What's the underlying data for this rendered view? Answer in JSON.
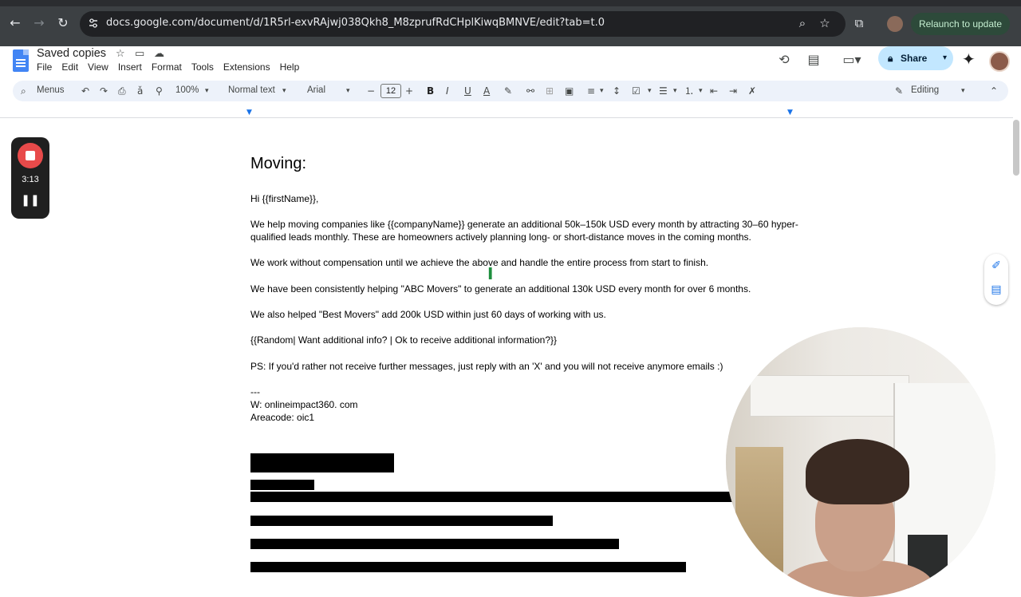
{
  "browser": {
    "url": "docs.google.com/document/d/1R5rl-exvRAjwj038Qkh8_M8zprufRdCHplKiwqBMNVE/edit?tab=t.0",
    "relaunch_label": "Relaunch to update"
  },
  "docs": {
    "title": "Saved copies",
    "menu": [
      "File",
      "Edit",
      "View",
      "Insert",
      "Format",
      "Tools",
      "Extensions",
      "Help"
    ],
    "share_label": "Share"
  },
  "toolbar": {
    "search_label": "Menus",
    "zoom": "100%",
    "style": "Normal text",
    "font": "Arial",
    "font_size": "12",
    "mode": "Editing"
  },
  "document": {
    "heading": "Moving:",
    "greeting": "Hi {{firstName}},",
    "p1": "We help moving companies like {{companyName}} generate an additional 50k–150k USD every month by attracting 30–60 hyper-qualified leads monthly. These are homeowners actively planning long- or short-distance moves in the coming months.",
    "p2": "We work without compensation until we achieve the above and handle the entire process from start to finish.",
    "p3": "We have been consistently helping \"ABC Movers\" to generate an additional 130k USD every month for over 6 months.",
    "p4": "We also helped \"Best Movers\" add 200k USD within just 60 days of working with us.",
    "p5": "{{Random| Want additional info? | Ok to receive additional information?}}",
    "p6": "PS: If you'd rather not receive further messages, just reply with an 'X' and you will not receive anymore emails :)",
    "sig_sep": "---",
    "sig_web": "W: onlineimpact360. com",
    "sig_area": "Areacode: oic1"
  },
  "recorder": {
    "time": "3:13"
  },
  "colors": {
    "chrome_bg": "#3c4043",
    "toolbar_bg": "#edf2fa",
    "share_bg": "#c2e7ff",
    "record_red": "#e84a4a"
  }
}
